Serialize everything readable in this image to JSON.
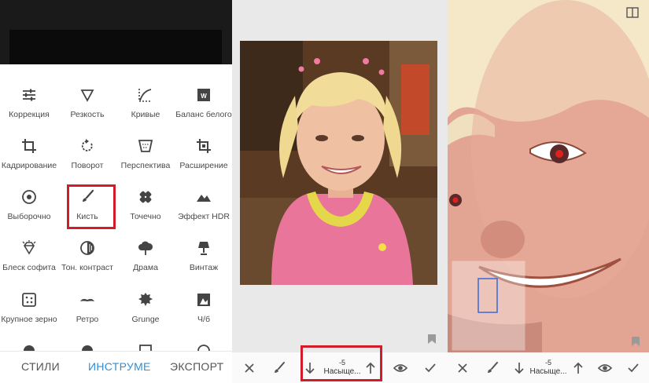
{
  "panel1": {
    "tools": [
      {
        "label": "Коррекция",
        "icon": "sliders-icon"
      },
      {
        "label": "Резкость",
        "icon": "triangle-down-icon"
      },
      {
        "label": "Кривые",
        "icon": "curves-icon"
      },
      {
        "label": "Баланс белого",
        "icon": "white-balance-icon"
      },
      {
        "label": "Кадрирование",
        "icon": "crop-icon"
      },
      {
        "label": "Поворот",
        "icon": "rotate-icon"
      },
      {
        "label": "Перспектива",
        "icon": "perspective-icon"
      },
      {
        "label": "Расширение",
        "icon": "expand-icon"
      },
      {
        "label": "Выборочно",
        "icon": "target-icon"
      },
      {
        "label": "Кисть",
        "icon": "brush-icon"
      },
      {
        "label": "Точечно",
        "icon": "bandage-icon"
      },
      {
        "label": "Эффект HDR",
        "icon": "mountains-icon"
      },
      {
        "label": "Блеск софита",
        "icon": "diamond-icon"
      },
      {
        "label": "Тон. контраст",
        "icon": "tonal-contrast-icon"
      },
      {
        "label": "Драма",
        "icon": "cloud-icon"
      },
      {
        "label": "Винтаж",
        "icon": "lamp-icon"
      },
      {
        "label": "Крупное зерно",
        "icon": "grain-icon"
      },
      {
        "label": "Ретро",
        "icon": "mustache-icon"
      },
      {
        "label": "Grunge",
        "icon": "grunge-icon"
      },
      {
        "label": "Ч/б",
        "icon": "bw-icon"
      }
    ],
    "tabs": {
      "styles": "СТИЛИ",
      "tools": "ИНСТРУМЕ",
      "export": "ЭКСПОРТ"
    },
    "active_color": "#2f8fd8",
    "highlight_color": "#d11c2a"
  },
  "panel2": {
    "param_value": "-5",
    "param_name": "Насыще...",
    "icons": [
      "close-icon",
      "brush-icon",
      "arrow-down-icon",
      "arrow-up-icon",
      "eye-icon",
      "check-icon"
    ]
  },
  "panel3": {
    "param_value": "-5",
    "param_name": "Насыще...",
    "icons": [
      "close-icon",
      "brush-icon",
      "arrow-down-icon",
      "arrow-up-icon",
      "eye-icon",
      "check-icon"
    ]
  }
}
